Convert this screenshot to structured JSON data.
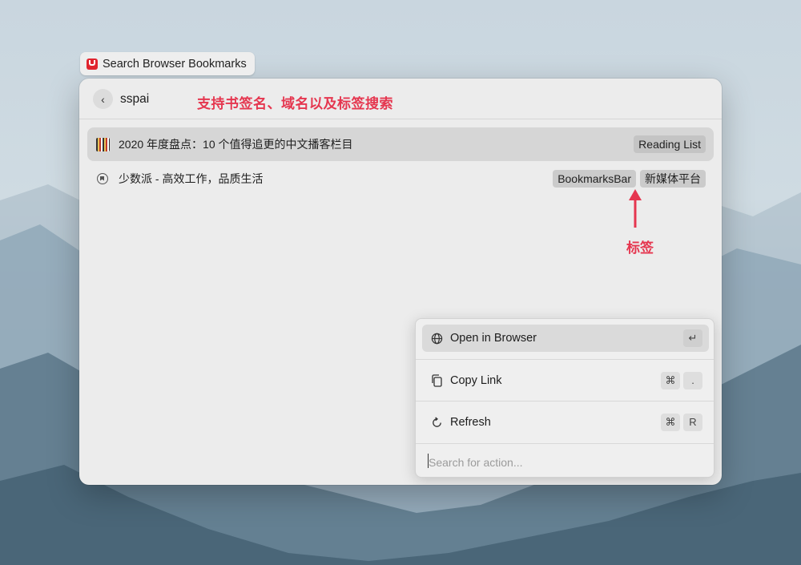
{
  "extension": {
    "title": "Search Browser Bookmarks",
    "logo": "raycast-logo-icon"
  },
  "search": {
    "query": "sspai",
    "back_icon": "chevron-left-icon"
  },
  "annotations": {
    "search_hint": "支持书签名、域名以及标签搜索",
    "tag_hint": "标签",
    "accent": "#e5364f"
  },
  "results": [
    {
      "title": "2020 年度盘点：10 个值得追更的中文播客栏目",
      "icon": "favicon-image",
      "tags": [
        "Reading List"
      ],
      "selected": true
    },
    {
      "title": "少数派 - 高效工作，品质生活",
      "icon": "bookmark-icon",
      "tags": [
        "BookmarksBar",
        "新媒体平台"
      ],
      "selected": false
    }
  ],
  "actions": [
    {
      "label": "Open in Browser",
      "icon": "globe-icon",
      "keys": [
        "↵"
      ],
      "selected": true
    },
    {
      "label": "Copy Link",
      "icon": "copy-icon",
      "keys": [
        "⌘",
        "."
      ],
      "selected": false
    },
    {
      "label": "Refresh",
      "icon": "refresh-icon",
      "keys": [
        "⌘",
        "R"
      ],
      "selected": false
    }
  ],
  "action_search": {
    "placeholder": "Search for action..."
  }
}
